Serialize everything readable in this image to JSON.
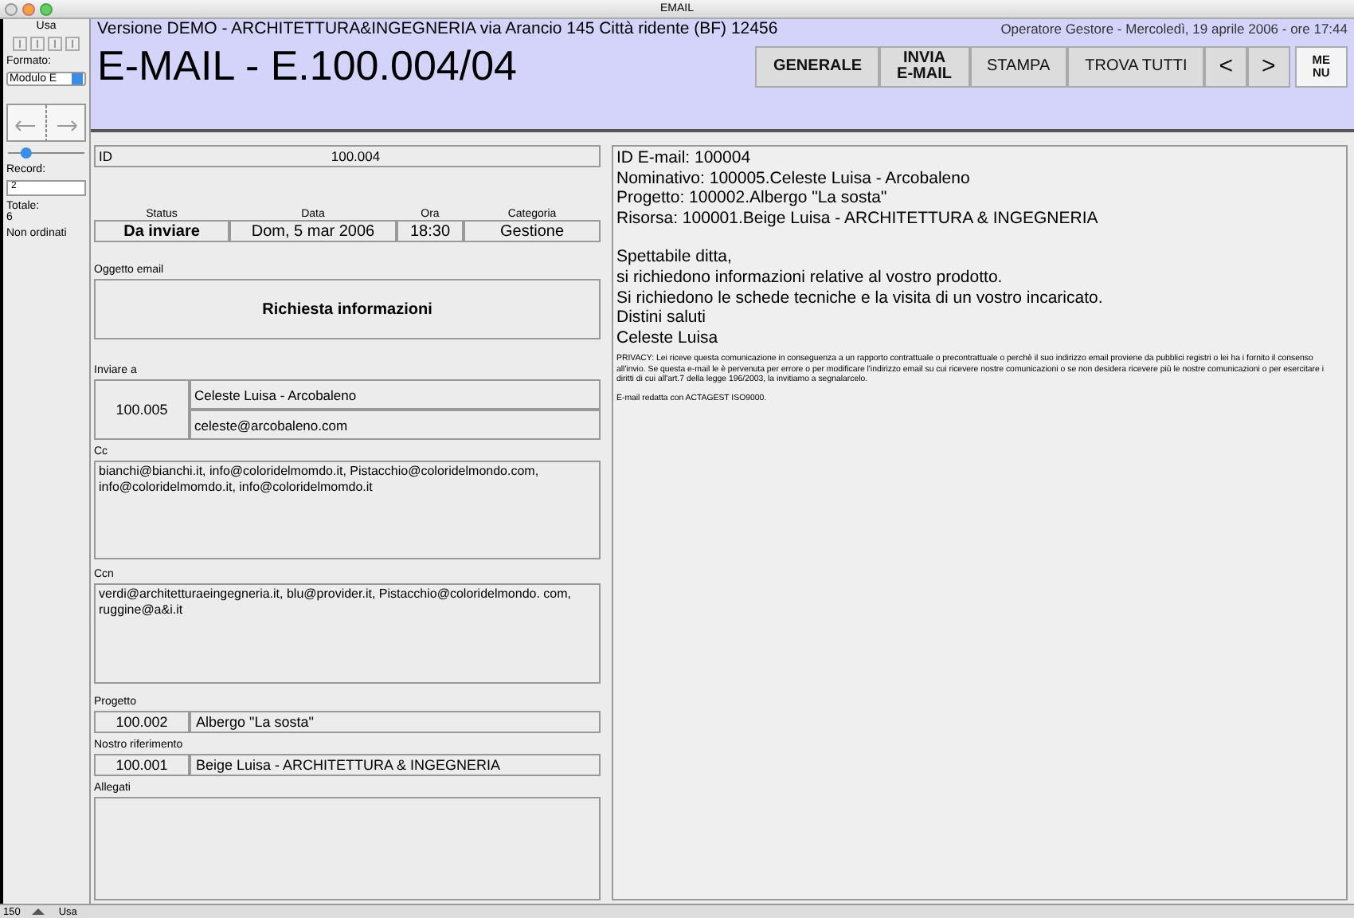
{
  "window": {
    "title": "EMAIL"
  },
  "sidebar": {
    "mode": "Usa",
    "format_label": "Formato:",
    "format_value": "Modulo E",
    "slider": {
      "level": 0.2
    },
    "record_label": "Record:",
    "record_value": "2",
    "total_label": "Totale:",
    "total_value": "6",
    "sort_status": "Non ordinati"
  },
  "header": {
    "company": "Versione DEMO - ARCHITETTURA&INGEGNERIA via Arancio 145 Città ridente (BF) 12456",
    "operator": "Operatore Gestore - Mercoledì, 19 aprile 2006 - ore 17:44",
    "title": "E-MAIL - E.100.004/04",
    "buttons": [
      {
        "label": "GENERALE",
        "kind": "bold"
      },
      {
        "label": "INVIA\nE-MAIL",
        "kind": "bold"
      },
      {
        "label": "STAMPA",
        "kind": "plain"
      },
      {
        "label": "TROVA TUTTI",
        "kind": "plain"
      },
      {
        "label": "<",
        "kind": "arrow"
      },
      {
        "label": ">",
        "kind": "arrow"
      },
      {
        "label": "ME\nNU",
        "kind": "menu"
      }
    ]
  },
  "form": {
    "id_label": "ID",
    "id_value": "100.004",
    "columns": [
      {
        "label": "Status",
        "value": "Da inviare",
        "bold": true
      },
      {
        "label": "Data",
        "value": "Dom, 5 mar 2006",
        "bold": false
      },
      {
        "label": "Ora",
        "value": "18:30",
        "bold": false
      },
      {
        "label": "Categoria",
        "value": "Gestione",
        "bold": false
      }
    ],
    "subject_label": "Oggetto email",
    "subject": "Richiesta informazioni",
    "to_label": "Inviare a",
    "to_code": "100.005",
    "to_name": "Celeste Luisa - Arcobaleno",
    "to_email": "celeste@arcobaleno.com",
    "cc_label": "Cc",
    "cc": "bianchi@bianchi.it, info@coloridelmomdo.it, Pistacchio@coloridelmondo.com, info@coloridelmomdo.it, info@coloridelmomdo.it",
    "ccn_label": "Ccn",
    "ccn": "verdi@architetturaeingegneria.it, blu@provider.it, Pistacchio@coloridelmondo. com, ruggine@a&i.it",
    "project_label": "Progetto",
    "project_code": "100.002",
    "project_name": "Albergo \"La sosta\"",
    "reference_label": "Nostro riferimento",
    "reference_code": "100.001",
    "reference_name": "Beige Luisa - ARCHITETTURA & INGEGNERIA",
    "attachments_label": "Allegati"
  },
  "body": {
    "header_lines": [
      "ID E-mail: 100004",
      "Nominativo: 100005.Celeste Luisa - Arcobaleno",
      "Progetto: 100002.Albergo \"La sosta\"",
      "Risorsa: 100001.Beige Luisa - ARCHITETTURA & INGEGNERIA"
    ],
    "message_lines": [
      "Spettabile ditta,",
      "si richiedono informazioni relative al vostro prodotto.",
      "Si richiedono le schede tecniche e la visita di un vostro incaricato.",
      "Distini saluti",
      "Celeste Luisa"
    ],
    "privacy": "PRIVACY: Lei riceve questa comunicazione in conseguenza a un rapporto contrattuale o precontrattuale o perchè il suo indirizzo email proviene da pubblici registri o lei ha i fornito il consenso all'invio. Se questa e-mail le è pervenuta per errore o per modificare l'indirizzo email su cui ricevere nostre comunicazioni o se non desidera ricevere più le nostre comunicazioni o per esercitare i diritti di cui all'art.7 della legge 196/2003,  la invitiamo a segnalarcelo.",
    "footer": "E-mail redatta con ACTAGEST ISO9000."
  },
  "status_bar": {
    "zoom": "150",
    "mode": "Usa"
  }
}
